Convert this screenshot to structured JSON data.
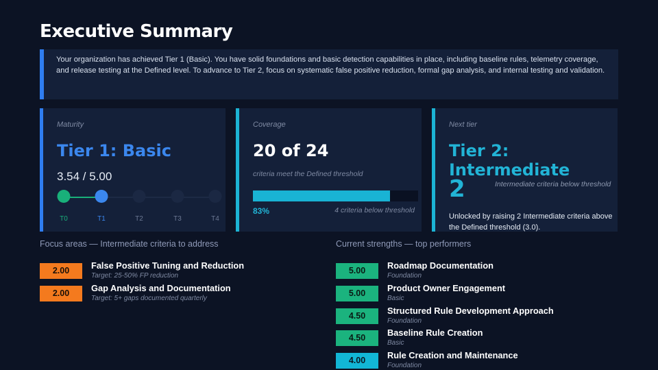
{
  "title": "Executive Summary",
  "summary": "Your organization has achieved Tier 1 (Basic). You have solid foundations and basic detection capabilities in place, including baseline rules, telemetry coverage, and release testing at the Defined level. To advance to Tier 2, focus on systematic false positive reduction, formal gap analysis, and internal testing and validation.",
  "colors": {
    "accent_blue": "#2f7df0",
    "accent_cyan": "#1cb3d4",
    "green": "#19b07a",
    "orange": "#f47a1e",
    "background": "#0c1324",
    "card": "#142039"
  },
  "maturity": {
    "label": "Maturity",
    "tier": "Tier 1: Basic",
    "score": "3.54 / 5.00",
    "current_index": 1,
    "tiers": [
      "T0",
      "T1",
      "T2",
      "T3",
      "T4"
    ]
  },
  "coverage": {
    "label": "Coverage",
    "value": "20 of 24",
    "sub": "criteria meet the Defined threshold",
    "progress": 0.83,
    "percent": "83%",
    "note": "4 criteria below threshold"
  },
  "next_tier": {
    "label": "Next tier",
    "tier": "Tier 2: Intermediate",
    "count": "2",
    "count_note": "Intermediate criteria below threshold",
    "unlock": "Unlocked by raising 2 Intermediate criteria above the Defined threshold (3.0)."
  },
  "focus": {
    "heading": "Focus areas — Intermediate criteria to address",
    "items": [
      {
        "score": "2.00",
        "name": "False Positive Tuning and Reduction",
        "target": "Target: 25-50% FP reduction",
        "color": "orange"
      },
      {
        "score": "2.00",
        "name": "Gap Analysis and Documentation",
        "target": "Target: 5+ gaps documented quarterly",
        "color": "orange"
      }
    ]
  },
  "strengths": {
    "heading": "Current strengths — top performers",
    "items": [
      {
        "score": "5.00",
        "name": "Roadmap Documentation",
        "tier": "Foundation",
        "color": "green"
      },
      {
        "score": "5.00",
        "name": "Product Owner Engagement",
        "tier": "Basic",
        "color": "green"
      },
      {
        "score": "4.50",
        "name": "Structured Rule Development Approach",
        "tier": "Foundation",
        "color": "green"
      },
      {
        "score": "4.50",
        "name": "Baseline Rule Creation",
        "tier": "Basic",
        "color": "green"
      },
      {
        "score": "4.00",
        "name": "Rule Creation and Maintenance",
        "tier": "Foundation",
        "color": "teal"
      }
    ]
  }
}
